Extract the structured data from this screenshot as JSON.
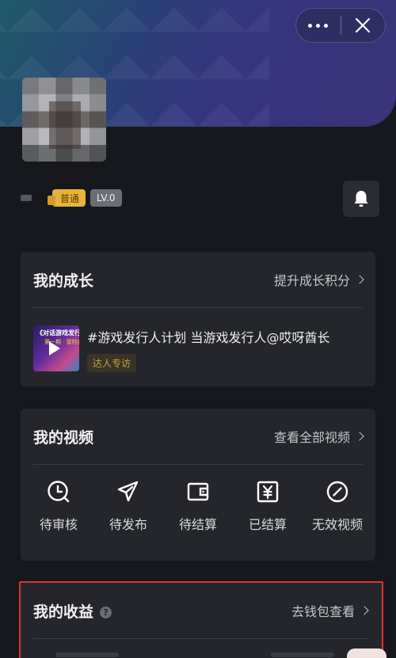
{
  "header": {
    "more_icon": "more-dots-icon",
    "close_icon": "close-icon"
  },
  "profile": {
    "badge_normal": "普通",
    "badge_level": "LV.0",
    "bell_icon": "bell-icon"
  },
  "growth": {
    "title": "我的成长",
    "link": "提升成长积分",
    "item": {
      "thumb_title": "《对话游戏发行人》",
      "thumb_sub": "第一期 · 冒险者之光",
      "title": "#游戏发行人计划 当游戏发行人@哎呀酋长",
      "tag": "达人专访"
    }
  },
  "videos": {
    "title": "我的视频",
    "link": "查看全部视频",
    "items": [
      {
        "label": "待审核",
        "icon": "clock-icon"
      },
      {
        "label": "待发布",
        "icon": "send-icon"
      },
      {
        "label": "待结算",
        "icon": "wallet-icon"
      },
      {
        "label": "已结算",
        "icon": "yen-icon"
      },
      {
        "label": "无效视频",
        "icon": "invalid-icon"
      }
    ]
  },
  "income": {
    "title": "我的收益",
    "help_icon": "question-icon",
    "link": "去钱包查看"
  },
  "colors": {
    "background": "#16181d",
    "card": "#24262c",
    "accent_gold": "#e6b33c",
    "highlight_border": "#e0322f"
  }
}
